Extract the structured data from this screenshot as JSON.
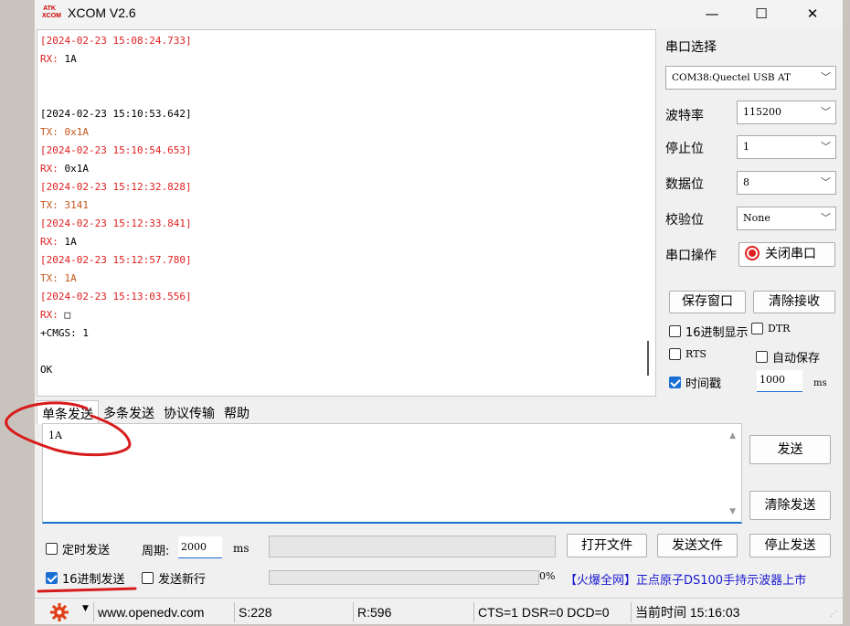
{
  "app": {
    "title": "XCOM V2.6",
    "logo_text": "ATK XCOM"
  },
  "window_controls": {
    "minimize": "—",
    "maximize": "☐",
    "close": "✕"
  },
  "receive": {
    "lines": [
      {
        "text": "[2024-02-23 15:08:24.733]",
        "color": "red"
      },
      {
        "text": "RX: 1A",
        "color": "red_prefix",
        "prefix": "RX:",
        "rest": " 1A"
      },
      {
        "text": "",
        "color": "black"
      },
      {
        "text": "",
        "color": "black"
      },
      {
        "text": "[2024-02-23 15:10:53.642]",
        "color": "black"
      },
      {
        "text": "TX: 0x1A",
        "color": "brown"
      },
      {
        "text": "[2024-02-23 15:10:54.653]",
        "color": "red"
      },
      {
        "text": "RX: 0x1A",
        "color": "red_prefix",
        "prefix": "RX:",
        "rest": " 0x1A"
      },
      {
        "text": "[2024-02-23 15:12:32.828]",
        "color": "red"
      },
      {
        "text": "TX: 3141",
        "color": "brown"
      },
      {
        "text": "[2024-02-23 15:12:33.841]",
        "color": "red"
      },
      {
        "text": "RX: 1A",
        "color": "red_prefix",
        "prefix": "RX:",
        "rest": " 1A"
      },
      {
        "text": "[2024-02-23 15:12:57.780]",
        "color": "red"
      },
      {
        "text": "TX: 1A",
        "color": "brown"
      },
      {
        "text": "[2024-02-23 15:13:03.556]",
        "color": "red"
      },
      {
        "text": "RX: □",
        "color": "red_prefix",
        "prefix": "RX:",
        "rest": " □"
      },
      {
        "text": "+CMGS: 1",
        "color": "black"
      },
      {
        "text": "",
        "color": "black"
      },
      {
        "text": "OK",
        "color": "black"
      }
    ]
  },
  "serial": {
    "port_label": "串口选择",
    "port_value": "COM38:Quectel USB AT",
    "baud_label": "波特率",
    "baud_value": "115200",
    "stop_label": "停止位",
    "stop_value": "1",
    "data_label": "数据位",
    "data_value": "8",
    "parity_label": "校验位",
    "parity_value": "None",
    "op_label": "串口操作",
    "op_button": "关闭串口"
  },
  "recv_controls": {
    "save_window": "保存窗口",
    "clear_recv": "清除接收",
    "hex_display": "16进制显示",
    "hex_display_checked": false,
    "dtr": "DTR",
    "dtr_checked": false,
    "rts": "RTS",
    "rts_checked": false,
    "auto_save": "自动保存",
    "auto_save_checked": false,
    "timestamp": "时间戳",
    "timestamp_checked": true,
    "timestamp_ms": "1000",
    "ms_unit": "ms"
  },
  "tabs": [
    "单条发送",
    "多条发送",
    "协议传输",
    "帮助"
  ],
  "send": {
    "text": "1A",
    "send_button": "发送",
    "clear_send_button": "清除发送"
  },
  "bottom": {
    "timed_send": "定时发送",
    "timed_send_checked": false,
    "period_label": "周期:",
    "period_value": "2000",
    "period_unit": "ms",
    "open_file": "打开文件",
    "send_file": "发送文件",
    "stop_send": "停止发送",
    "hex_send": "16进制发送",
    "hex_send_checked": true,
    "newline": "发送新行",
    "newline_checked": false,
    "progress_pct": "0%",
    "ad_link": "【火爆全网】正点原子DS100手持示波器上市"
  },
  "statusbar": {
    "website": "www.openedv.com",
    "sent": "S:228",
    "received": "R:596",
    "lines": "CTS=1 DSR=0 DCD=0",
    "time": "当前时间 15:16:03"
  },
  "colors": {
    "accent": "#1a6fd4",
    "rx_red": "#e02020",
    "tx_brown": "#c4561c",
    "annotation_red": "#d81b1b"
  }
}
